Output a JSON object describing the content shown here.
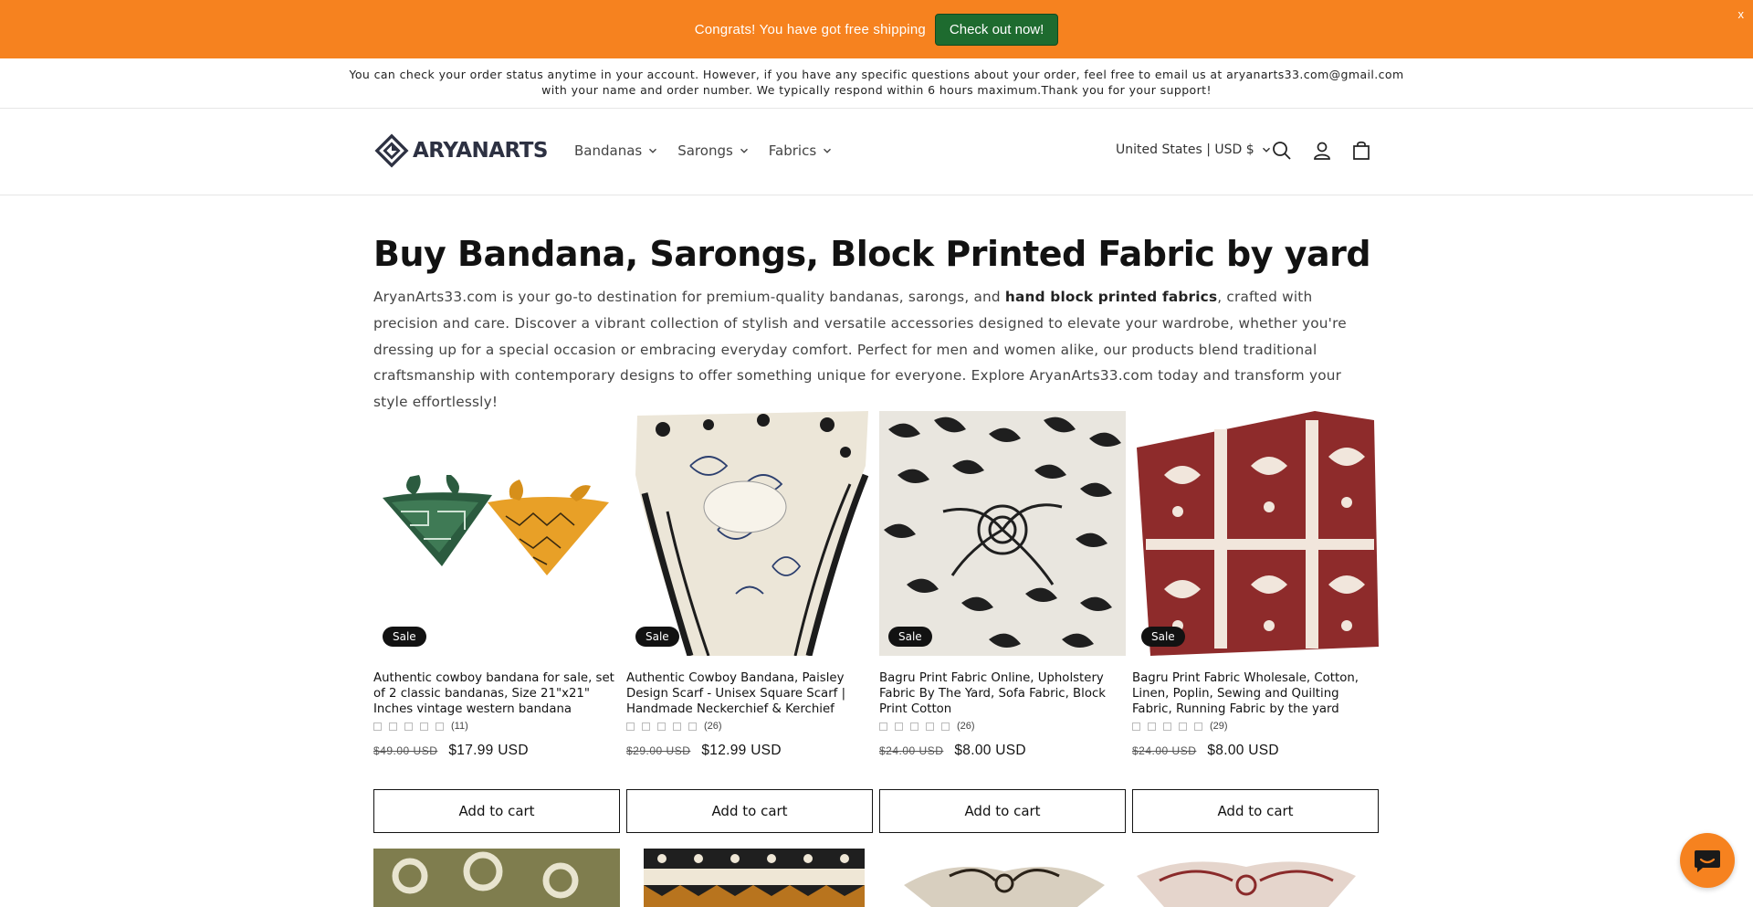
{
  "promo": {
    "text": "Congrats! You have got free shipping",
    "button": "Check out now!",
    "close": "x"
  },
  "announcement": {
    "line1": "You can check your order status anytime in your account. However, if you have any specific questions about your order, feel free to email us at aryanarts33.com@gmail.com",
    "line2": "with your name and order number. We typically respond within 6 hours maximum.Thank you for your support!"
  },
  "header": {
    "logo_text": "ARYANARTS",
    "nav": [
      {
        "label": "Bandanas"
      },
      {
        "label": "Sarongs"
      },
      {
        "label": "Fabrics"
      }
    ],
    "country": "United States | USD $",
    "icons": [
      "search-icon",
      "account-icon",
      "cart-icon"
    ]
  },
  "main": {
    "title": "Buy Bandana, Sarongs, Block Printed Fabric by yard",
    "desc_part1": "AryanArts33.com is your go-to destination for premium-quality bandanas, sarongs, and ",
    "desc_bold": "hand block printed fabrics",
    "desc_part2": ", crafted with precision and care. Discover a vibrant collection of stylish and versatile accessories designed to elevate your wardrobe, whether you're dressing up for a special occasion or embracing everyday comfort. Perfect for men and women alike, our products blend traditional craftsmanship with contemporary designs to offer something unique for everyone. Explore AryanArts33.com today and transform your style effortlessly!"
  },
  "products": [
    {
      "badge": "Sale",
      "name": "Authentic cowboy bandana for sale, set of 2 classic bandanas, Size 21\"x21\" Inches vintage western bandana",
      "reviews": "(11)",
      "old_price": "$49.00 USD",
      "price": "$17.99 USD",
      "button": "Add to cart"
    },
    {
      "badge": "Sale",
      "name": "Authentic Cowboy Bandana, Paisley Design Scarf - Unisex Square Scarf | Handmade Neckerchief & Kerchief",
      "reviews": "(26)",
      "old_price": "$29.00 USD",
      "price": "$12.99 USD",
      "button": "Add to cart"
    },
    {
      "badge": "Sale",
      "name": "Bagru Print Fabric Online, Upholstery Fabric By The Yard, Sofa Fabric, Block Print Cotton",
      "reviews": "(26)",
      "old_price": "$24.00 USD",
      "price": "$8.00 USD",
      "button": "Add to cart"
    },
    {
      "badge": "Sale",
      "name": "Bagru Print Fabric Wholesale, Cotton, Linen, Poplin, Sewing and Quilting Fabric, Running Fabric by the yard",
      "reviews": "(29)",
      "old_price": "$24.00 USD",
      "price": "$8.00 USD",
      "button": "Add to cart"
    }
  ],
  "colors": {
    "promo_bg": "#f6821f",
    "promo_button": "#1e6b2f",
    "badge_bg": "#121212"
  },
  "chat_icon": "chat-bubble-icon"
}
